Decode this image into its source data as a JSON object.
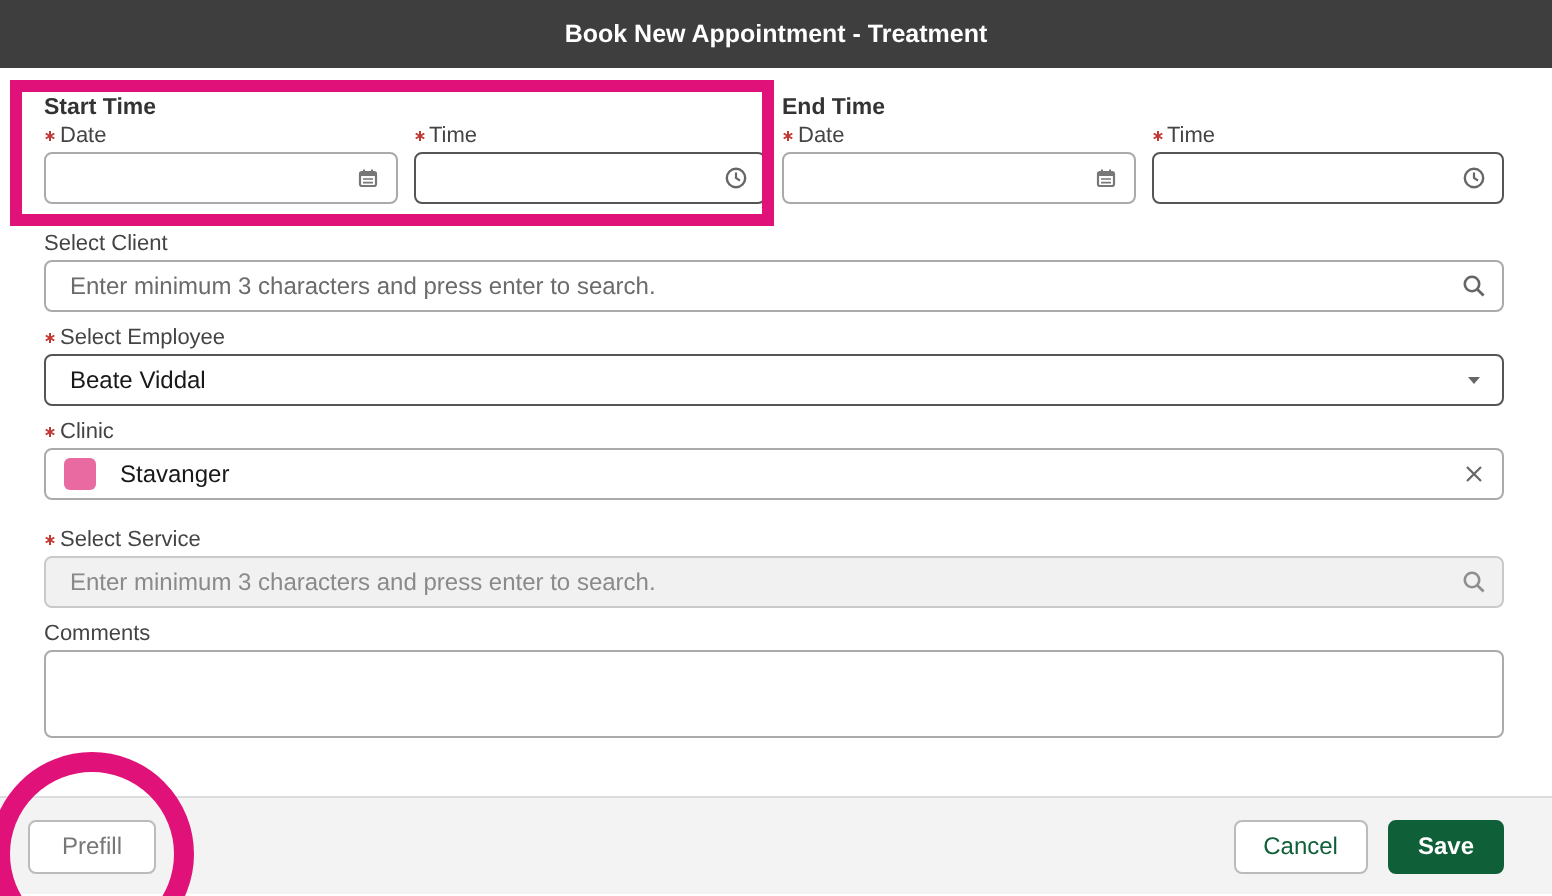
{
  "window": {
    "title": "Book New Appointment - Treatment"
  },
  "time_groups": [
    {
      "title": "Start Time",
      "fields": [
        {
          "label": "Date",
          "required": true,
          "kind": "date"
        },
        {
          "label": "Time",
          "required": true,
          "kind": "time"
        }
      ]
    },
    {
      "title": "End Time",
      "fields": [
        {
          "label": "Date",
          "required": true,
          "kind": "date"
        },
        {
          "label": "Time",
          "required": true,
          "kind": "time"
        }
      ]
    }
  ],
  "fields": [
    {
      "label": "Select Client",
      "required": false,
      "disabled": false,
      "kind": "search",
      "placeholder": "Enter minimum 3 characters and press enter to search."
    },
    {
      "label": "Select Employee",
      "required": true,
      "disabled": false,
      "kind": "select",
      "value": "Beate Viddal"
    },
    {
      "label": "Clinic",
      "required": true,
      "disabled": false,
      "kind": "lookup",
      "value": "Stavanger"
    },
    {
      "label": "Select Service",
      "required": true,
      "disabled": true,
      "kind": "search",
      "placeholder": "Enter minimum 3 characters and press enter to search."
    },
    {
      "label": "Comments",
      "required": false,
      "disabled": false,
      "kind": "textarea"
    }
  ],
  "footer": {
    "left_buttons": [
      {
        "label": "Prefill",
        "kind": "muted"
      }
    ],
    "right_buttons": [
      {
        "label": "Cancel",
        "kind": "neutral"
      },
      {
        "label": "Save",
        "kind": "brand"
      }
    ]
  },
  "annotations": {
    "highlight_rectangle": true,
    "highlight_circle": true
  }
}
